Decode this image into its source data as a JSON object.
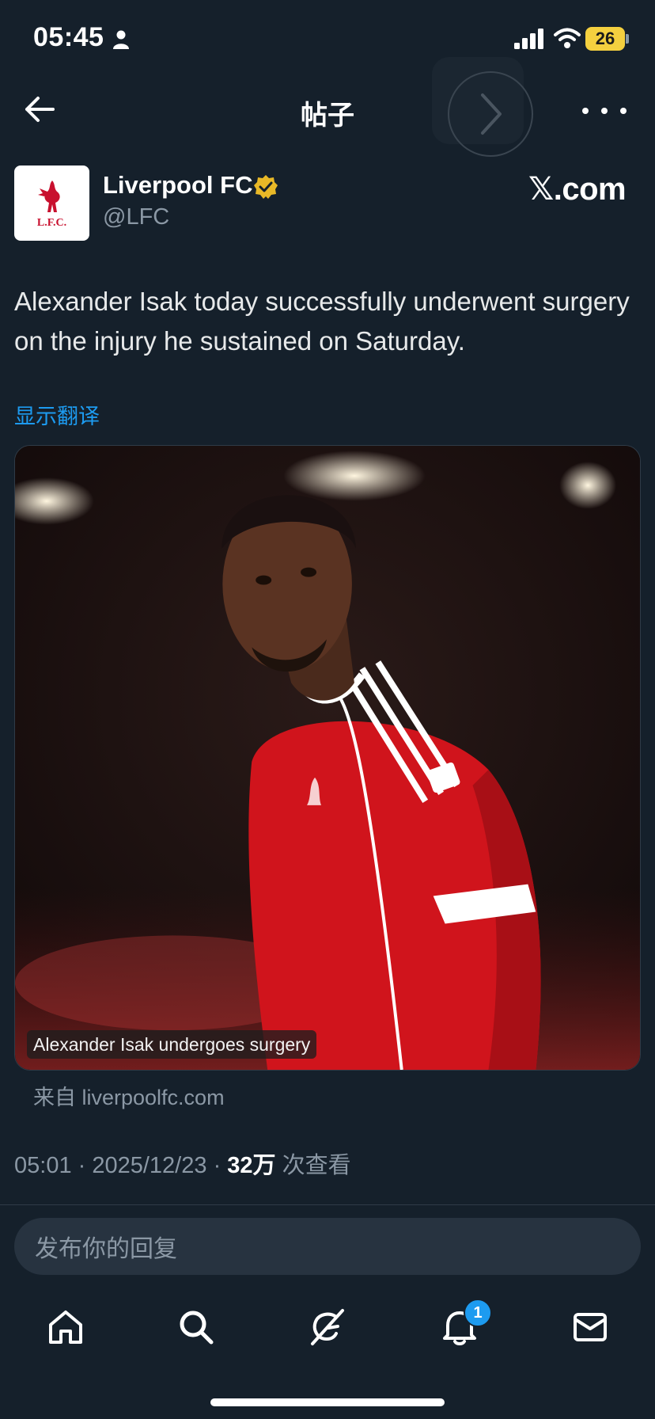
{
  "status_bar": {
    "time": "05:45",
    "battery": "26"
  },
  "header": {
    "title": "帖子"
  },
  "author": {
    "name": "Liverpool FC",
    "handle": "@LFC",
    "avatar_text": "L.F.C.",
    "brand": "𝕏.com"
  },
  "post": {
    "text": "Alexander Isak today successfully underwent surgery on the injury he sustained on Saturday.",
    "translate_label": "显示翻译",
    "media_caption": "Alexander Isak undergoes surgery",
    "source": "来自 liverpoolfc.com",
    "time": "05:01",
    "date": "2025/12/23",
    "views_count": "32万",
    "views_label": "次查看"
  },
  "reply": {
    "placeholder": "发布你的回复"
  },
  "tabs": [
    {
      "icon": "home-icon"
    },
    {
      "icon": "search-icon"
    },
    {
      "icon": "grok-icon"
    },
    {
      "icon": "bell-icon",
      "badge": "1"
    },
    {
      "icon": "mail-icon"
    }
  ],
  "colors": {
    "background": "#15202b",
    "accent": "#1d9bf0",
    "verified": "#e8b827",
    "kit_red": "#c8102e"
  }
}
